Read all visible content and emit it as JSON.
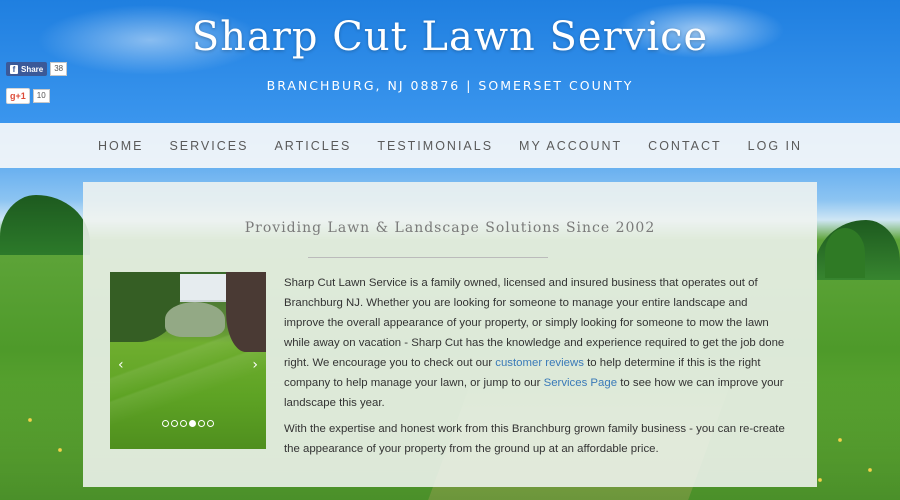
{
  "header": {
    "title": "Sharp Cut Lawn Service",
    "subtitle": "BRANCHBURG, NJ 08876 | SOMERSET COUNTY"
  },
  "social": {
    "facebook_label": "Share",
    "facebook_icon": "f",
    "facebook_count": "38",
    "gplus_label": "g+1",
    "gplus_count": "10"
  },
  "nav": {
    "items": [
      {
        "label": "HOME"
      },
      {
        "label": "SERVICES"
      },
      {
        "label": "ARTICLES"
      },
      {
        "label": "TESTIMONIALS"
      },
      {
        "label": "MY ACCOUNT"
      },
      {
        "label": "CONTACT"
      },
      {
        "label": "LOG IN"
      }
    ]
  },
  "main": {
    "tagline": "Providing Lawn & Landscape Solutions Since 2002",
    "slider": {
      "prev": "‹",
      "next": "›",
      "dot_count": 6,
      "active_dot": 3
    },
    "para1_a": "Sharp Cut Lawn Service is a family owned, licensed and insured business that operates out of Branchburg NJ. Whether you are looking for someone to manage your entire landscape and improve the overall appearance of your property, or simply looking for someone to mow the lawn while away on vacation - Sharp Cut has the knowledge and experience required to get the job done right. We encourage you to check out our ",
    "link_reviews": "customer reviews",
    "para1_b": " to help determine if this is the right company to help manage your lawn, or jump to our ",
    "link_services": "Services Page",
    "para1_c": " to see how we can improve your landscape this year.",
    "para2": "With the expertise and honest work from this Branchburg grown family business - you can re-create the appearance of your property from the ground up at an affordable price."
  },
  "colors": {
    "link": "#3a7ab8",
    "facebook": "#3b5998",
    "gplus": "#dd4b39"
  }
}
